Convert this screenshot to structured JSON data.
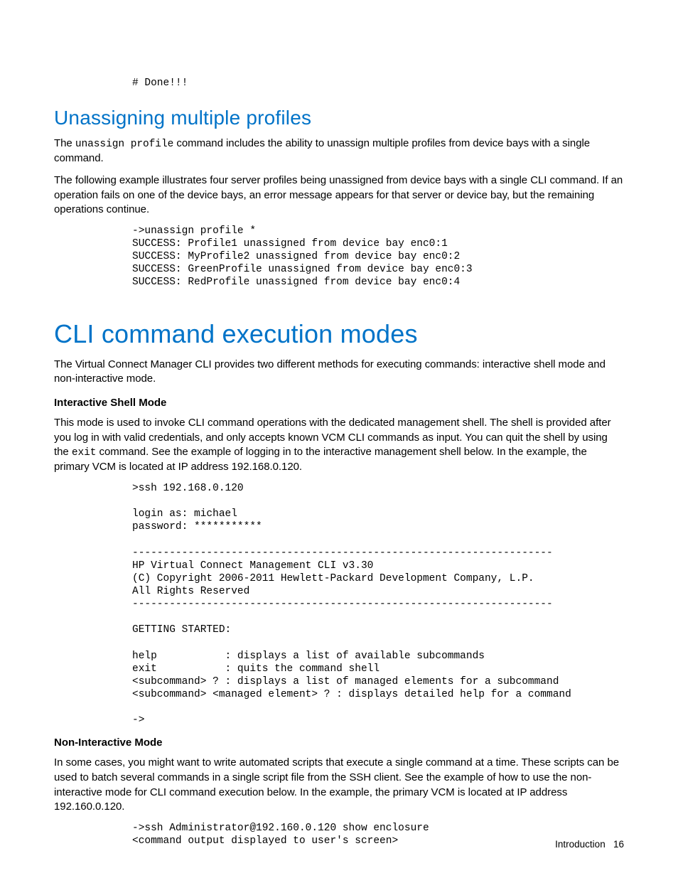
{
  "topCode": "# Done!!!",
  "h2_unassign": "Unassigning multiple profiles",
  "para_unassign_1a": "The ",
  "para_unassign_1_cmd": "unassign profile",
  "para_unassign_1b": " command includes the ability to unassign multiple profiles from device bays with a single command.",
  "para_unassign_2": "The following example illustrates four server profiles being unassigned from device bays with a single CLI command. If an operation fails on one of the device bays, an error message appears for that server or device bay, but the remaining operations continue.",
  "code_unassign": "->unassign profile *\nSUCCESS: Profile1 unassigned from device bay enc0:1\nSUCCESS: MyProfile2 unassigned from device bay enc0:2\nSUCCESS: GreenProfile unassigned from device bay enc0:3\nSUCCESS: RedProfile unassigned from device bay enc0:4",
  "h1_cli": "CLI command execution modes",
  "para_cli_1": "The Virtual Connect Manager CLI provides two different methods for executing commands: interactive shell mode and non-interactive mode.",
  "sub_interactive": "Interactive Shell Mode",
  "para_interactive_a": "This mode is used to invoke CLI command operations with the dedicated management shell. The shell is provided after you log in with valid credentials, and only accepts known VCM CLI commands as input. You can quit the shell by using the ",
  "para_interactive_cmd": "exit",
  "para_interactive_b": " command. See the example of logging in to the interactive management shell below. In the example, the primary VCM is located at IP address 192.168.0.120.",
  "code_interactive": ">ssh 192.168.0.120\n\nlogin as: michael\npassword: ***********\n\n--------------------------------------------------------------------\nHP Virtual Connect Management CLI v3.30\n(C) Copyright 2006-2011 Hewlett-Packard Development Company, L.P.\nAll Rights Reserved\n--------------------------------------------------------------------\n\nGETTING STARTED:\n\nhelp           : displays a list of available subcommands\nexit           : quits the command shell\n<subcommand> ? : displays a list of managed elements for a subcommand\n<subcommand> <managed element> ? : displays detailed help for a command\n\n->",
  "sub_noninteractive": "Non-Interactive Mode",
  "para_noninteractive": "In some cases, you might want to write automated scripts that execute a single command at a time. These scripts can be used to batch several commands in a single script file from the SSH client. See the example of how to use the non-interactive mode for CLI command execution below. In the example, the primary VCM is located at IP address 192.160.0.120.",
  "code_noninteractive": "->ssh Administrator@192.160.0.120 show enclosure\n<command output displayed to user's screen>",
  "footer_label": "Introduction",
  "footer_page": "16"
}
